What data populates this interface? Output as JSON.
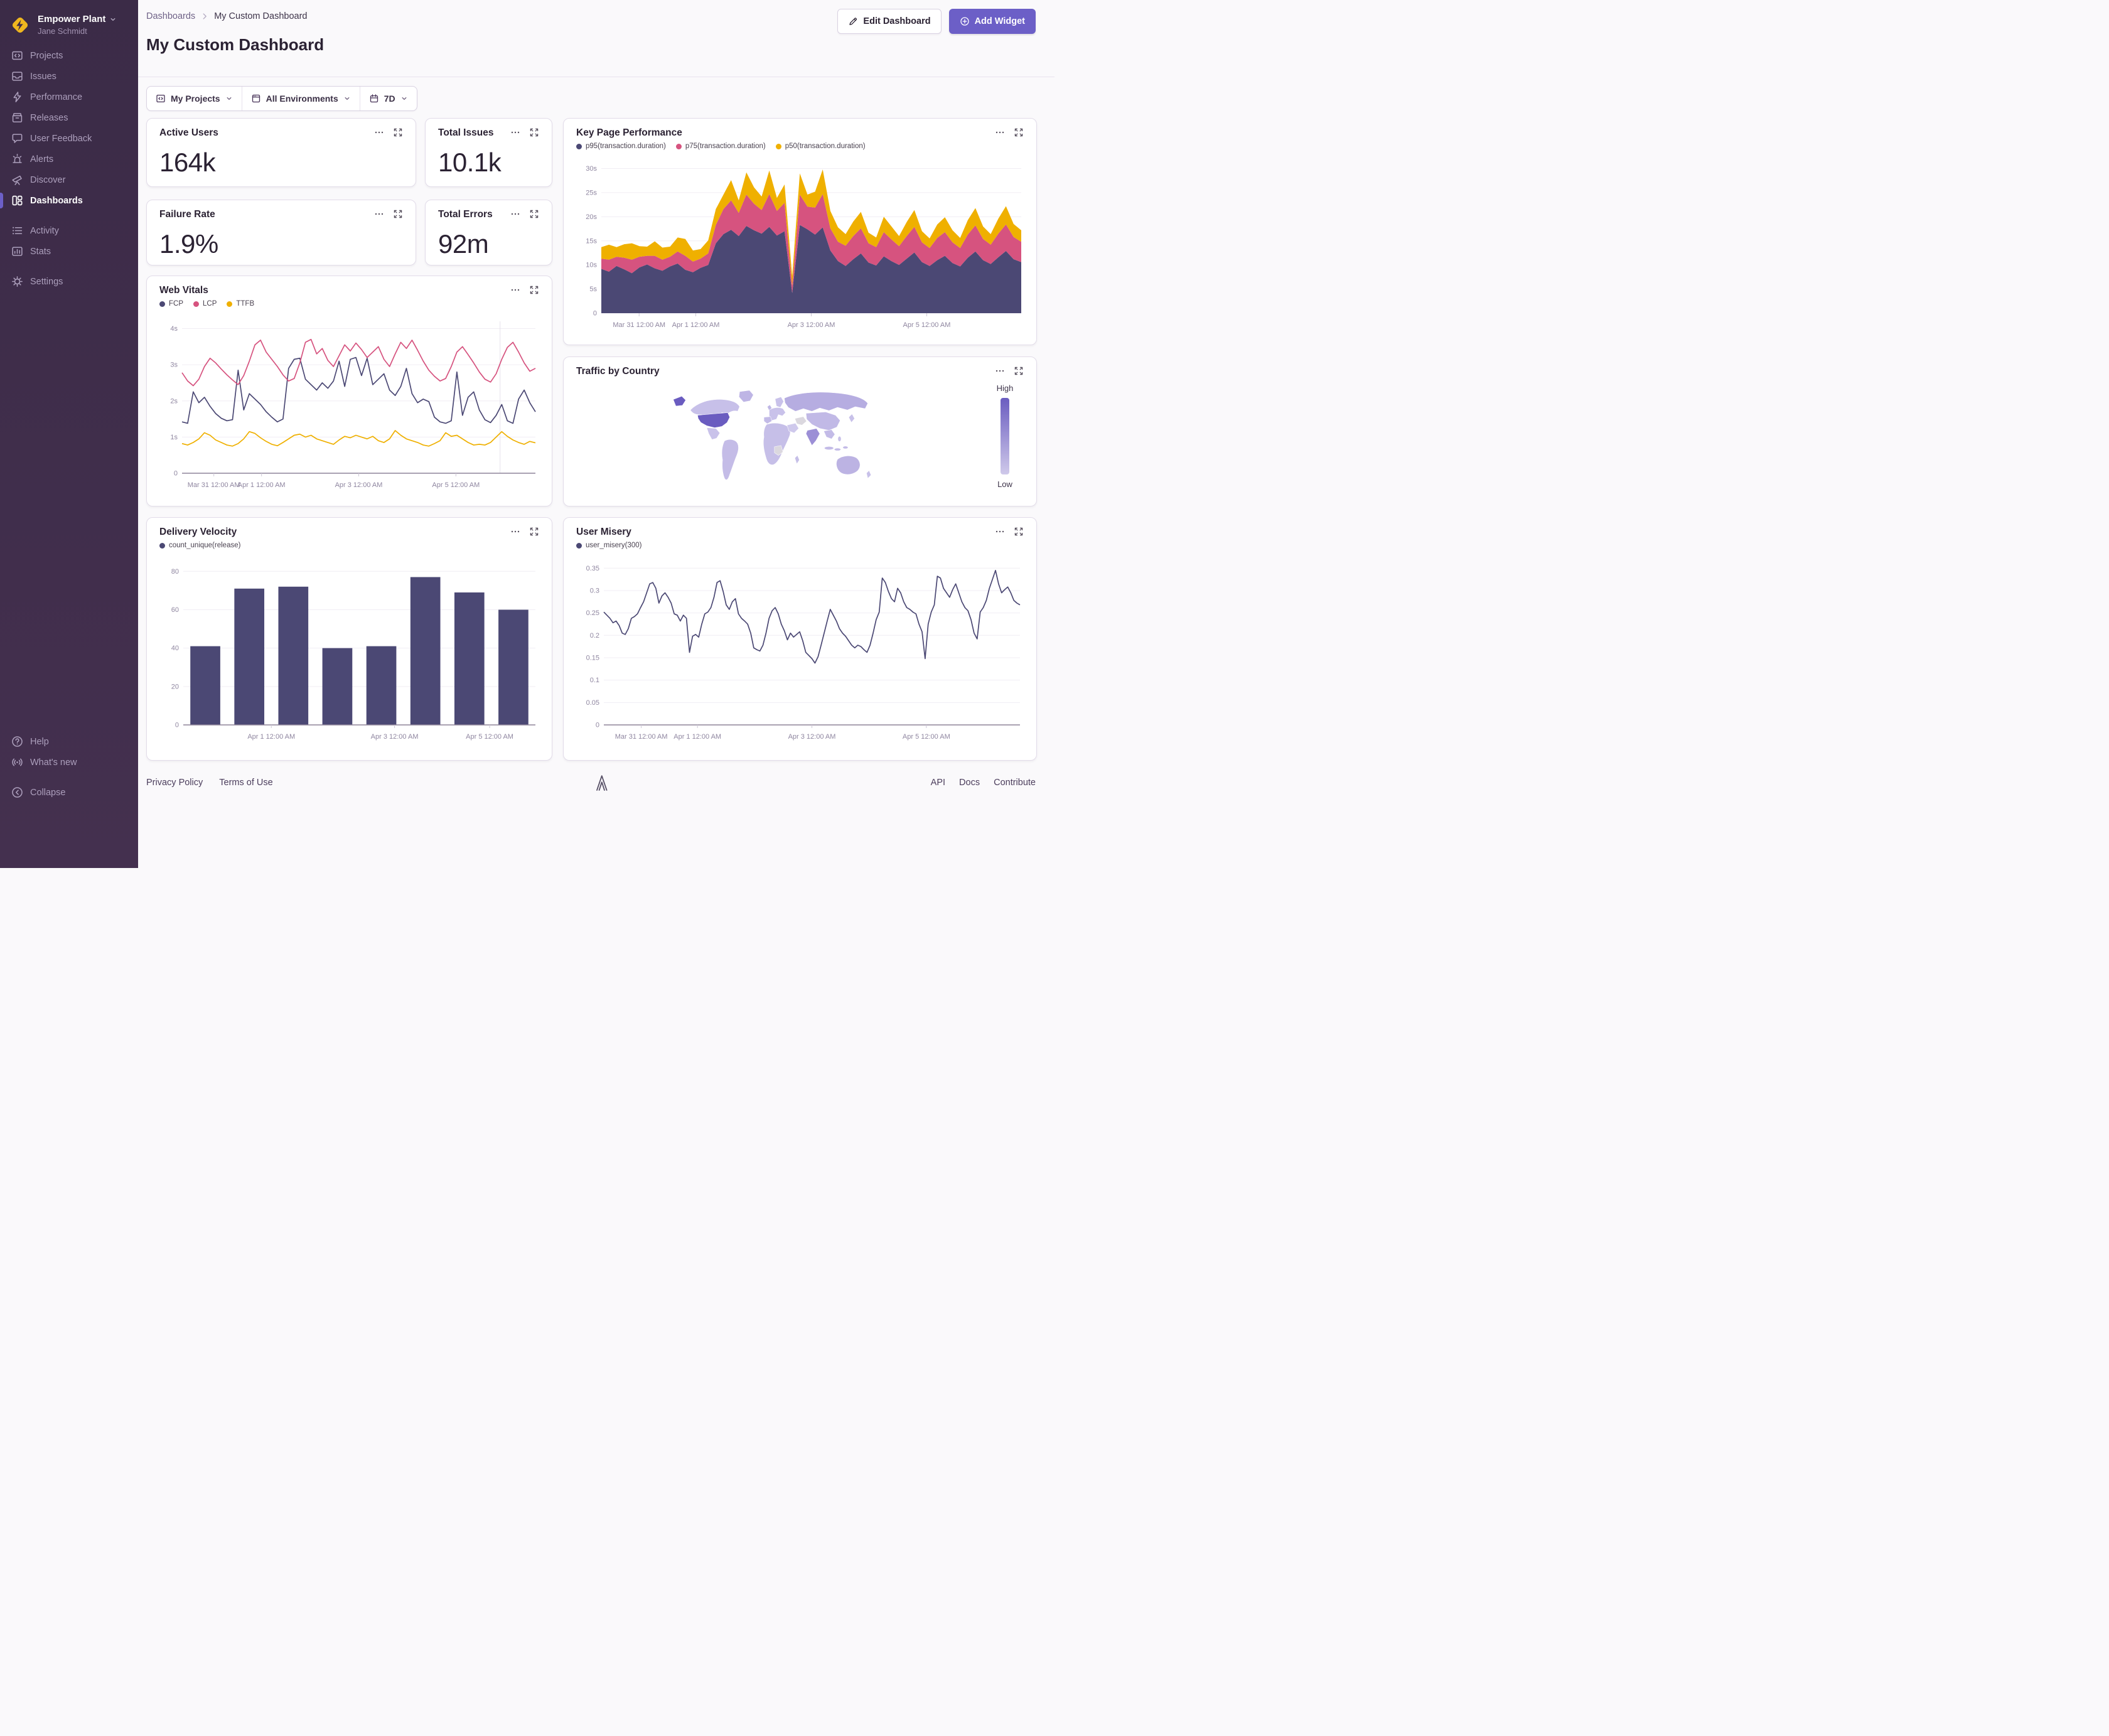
{
  "sidebar": {
    "org_name": "Empower Plant",
    "user_name": "Jane Schmidt",
    "items": [
      {
        "label": "Projects"
      },
      {
        "label": "Issues"
      },
      {
        "label": "Performance"
      },
      {
        "label": "Releases"
      },
      {
        "label": "User Feedback"
      },
      {
        "label": "Alerts"
      },
      {
        "label": "Discover"
      },
      {
        "label": "Dashboards",
        "active": true
      },
      {
        "label": "Activity"
      },
      {
        "label": "Stats"
      },
      {
        "label": "Settings"
      }
    ],
    "bottom_items": [
      {
        "label": "Help"
      },
      {
        "label": "What's new"
      },
      {
        "label": "Collapse"
      }
    ]
  },
  "header": {
    "breadcrumb": {
      "parent": "Dashboards",
      "current": "My Custom Dashboard"
    },
    "title": "My Custom Dashboard",
    "edit_button": "Edit Dashboard",
    "add_button": "Add Widget"
  },
  "filters": {
    "projects": "My Projects",
    "environments": "All Environments",
    "date_range": "7D"
  },
  "footer": {
    "privacy": "Privacy Policy",
    "terms": "Terms of Use",
    "api": "API",
    "docs": "Docs",
    "contribute": "Contribute"
  },
  "colors": {
    "accent": "#6C5FC7",
    "navy": "#4B4874",
    "pink": "#D6537F",
    "yellow": "#EFB000",
    "map_high": "#6A5CC0",
    "map_low": "#CFC9EA"
  },
  "chart_data": [
    {
      "id": "active-users",
      "type": "stat",
      "title": "Active Users",
      "value": "164k"
    },
    {
      "id": "total-issues",
      "type": "stat",
      "title": "Total Issues",
      "value": "10.1k"
    },
    {
      "id": "failure-rate",
      "type": "stat",
      "title": "Failure Rate",
      "value": "1.9%"
    },
    {
      "id": "total-errors",
      "type": "stat",
      "title": "Total Errors",
      "value": "92m"
    },
    {
      "id": "key-page-performance",
      "type": "area",
      "stacked": true,
      "title": "Key Page Performance",
      "ylim": [
        0,
        31.5
      ],
      "grid": true,
      "legend_position": "top-left",
      "axis_line": false,
      "yticks": [
        {
          "v": 0,
          "label": "0"
        },
        {
          "v": 5,
          "label": "5s"
        },
        {
          "v": 10,
          "label": "10s"
        },
        {
          "v": 15,
          "label": "15s"
        },
        {
          "v": 20,
          "label": "20s"
        },
        {
          "v": 25,
          "label": "25s"
        },
        {
          "v": 30,
          "label": "30s"
        }
      ],
      "xticks": [
        {
          "f": 0.09,
          "label": "Mar 31 12:00 AM"
        },
        {
          "f": 0.225,
          "label": "Apr 1 12:00 AM"
        },
        {
          "f": 0.5,
          "label": "Apr 3 12:00 AM"
        },
        {
          "f": 0.775,
          "label": "Apr 5 12:00 AM"
        }
      ],
      "series": [
        {
          "name": "p95(transaction.duration)",
          "color": "#4B4874",
          "values": [
            9.2,
            8.6,
            9.8,
            9.1,
            8.3,
            9.5,
            10.1,
            9.3,
            8.8,
            9.7,
            10.3,
            9.0,
            8.5,
            9.4,
            10.0,
            14.5,
            16.4,
            17.3,
            16.0,
            18.1,
            17.2,
            16.5,
            17.9,
            16.1,
            17.0,
            4.2,
            18.3,
            17.4,
            16.3,
            17.8,
            13.0,
            10.8,
            9.8,
            11.2,
            12.4,
            10.5,
            9.9,
            11.8,
            10.8,
            10.0,
            11.3,
            12.6,
            10.6,
            9.8,
            11.0,
            11.9,
            10.4,
            9.7,
            11.5,
            12.8,
            11.0,
            10.2,
            11.6,
            12.9,
            11.2,
            10.6
          ]
        },
        {
          "name": "p75(transaction.duration)",
          "color": "#D6537F",
          "values": [
            2.1,
            2.5,
            1.9,
            2.4,
            2.8,
            2.2,
            1.8,
            2.6,
            2.3,
            2.0,
            2.5,
            2.9,
            2.2,
            1.9,
            2.4,
            3.8,
            5.2,
            6.1,
            4.8,
            6.5,
            5.5,
            4.9,
            6.8,
            5.1,
            5.9,
            1.5,
            6.3,
            4.7,
            5.6,
            6.9,
            4.6,
            4.0,
            4.2,
            4.8,
            5.2,
            4.0,
            3.8,
            5.0,
            4.5,
            3.9,
            4.7,
            5.3,
            4.1,
            3.7,
            4.6,
            4.9,
            4.3,
            3.8,
            4.8,
            5.4,
            4.4,
            4.0,
            4.9,
            5.5,
            4.6,
            4.2
          ]
        },
        {
          "name": "p50(transaction.duration)",
          "color": "#EFB000",
          "values": [
            2.4,
            3.1,
            2.0,
            2.8,
            3.4,
            2.2,
            1.9,
            3.0,
            2.5,
            2.1,
            2.9,
            3.5,
            2.3,
            2.0,
            2.7,
            3.3,
            3.0,
            4.2,
            2.6,
            4.6,
            3.4,
            2.8,
            4.9,
            2.7,
            3.8,
            2.0,
            4.4,
            2.5,
            3.3,
            5.1,
            3.6,
            3.0,
            2.4,
            3.0,
            3.4,
            2.2,
            2.0,
            3.2,
            2.7,
            2.1,
            2.9,
            3.5,
            2.3,
            2.0,
            2.8,
            3.1,
            2.5,
            2.1,
            3.0,
            3.6,
            2.6,
            2.2,
            3.1,
            3.8,
            2.7,
            2.4
          ]
        }
      ]
    },
    {
      "id": "web-vitals",
      "type": "line",
      "title": "Web Vitals",
      "ylim": [
        0,
        4.2
      ],
      "grid": true,
      "legend_position": "top-left",
      "axis_line": true,
      "vline": 0.9,
      "yticks": [
        {
          "v": 0,
          "label": "0"
        },
        {
          "v": 1,
          "label": "1s"
        },
        {
          "v": 2,
          "label": "2s"
        },
        {
          "v": 3,
          "label": "3s"
        },
        {
          "v": 4,
          "label": "4s"
        }
      ],
      "xticks": [
        {
          "f": 0.09,
          "label": "Mar 31 12:00 AM"
        },
        {
          "f": 0.225,
          "label": "Apr 1 12:00 AM"
        },
        {
          "f": 0.5,
          "label": "Apr 3 12:00 AM"
        },
        {
          "f": 0.775,
          "label": "Apr 5 12:00 AM"
        }
      ],
      "series": [
        {
          "name": "FCP",
          "color": "#4B4874",
          "values": [
            1.42,
            1.38,
            2.25,
            1.95,
            2.1,
            1.85,
            1.65,
            1.52,
            1.45,
            1.48,
            2.85,
            1.75,
            2.2,
            2.05,
            1.9,
            1.7,
            1.55,
            1.42,
            1.5,
            2.9,
            3.15,
            3.18,
            2.6,
            2.45,
            2.3,
            2.5,
            2.35,
            2.55,
            3.1,
            2.4,
            3.15,
            3.2,
            2.7,
            3.18,
            2.45,
            2.6,
            2.75,
            2.3,
            2.15,
            2.4,
            2.9,
            2.2,
            1.95,
            2.05,
            1.98,
            1.55,
            1.42,
            1.38,
            1.45,
            2.8,
            1.6,
            2.1,
            2.25,
            1.75,
            1.48,
            1.4,
            1.6,
            1.9,
            1.45,
            1.38,
            2.05,
            2.3,
            1.95,
            1.7
          ]
        },
        {
          "name": "LCP",
          "color": "#D6537F",
          "values": [
            2.78,
            2.55,
            2.42,
            2.6,
            2.95,
            3.18,
            3.05,
            2.88,
            2.72,
            2.58,
            2.45,
            2.7,
            3.1,
            3.55,
            3.68,
            3.35,
            3.15,
            2.95,
            2.72,
            2.55,
            2.62,
            3.05,
            3.62,
            3.7,
            3.3,
            3.45,
            3.12,
            2.95,
            3.25,
            3.55,
            3.38,
            3.6,
            3.42,
            3.2,
            3.35,
            3.5,
            3.15,
            2.95,
            3.3,
            3.62,
            3.45,
            3.68,
            3.4,
            3.1,
            2.85,
            2.68,
            2.55,
            2.62,
            2.95,
            3.35,
            3.5,
            3.28,
            3.05,
            2.8,
            2.6,
            2.52,
            2.75,
            3.15,
            3.48,
            3.62,
            3.35,
            3.05,
            2.82,
            2.9
          ]
        },
        {
          "name": "TTFB",
          "color": "#EFB000",
          "values": [
            0.82,
            0.78,
            0.85,
            0.95,
            1.12,
            1.05,
            0.92,
            0.85,
            0.78,
            0.75,
            0.82,
            0.95,
            1.15,
            1.1,
            0.98,
            0.88,
            0.8,
            0.76,
            0.85,
            0.95,
            1.05,
            1.08,
            1.0,
            1.05,
            0.95,
            0.9,
            0.85,
            0.8,
            0.92,
            1.02,
            0.98,
            1.05,
            1.0,
            0.95,
            1.02,
            0.9,
            0.85,
            0.95,
            1.18,
            1.05,
            0.95,
            0.9,
            0.85,
            0.78,
            0.75,
            0.82,
            0.9,
            1.12,
            1.02,
            1.05,
            0.95,
            0.85,
            0.78,
            0.8,
            0.78,
            0.85,
            1.0,
            1.15,
            1.02,
            0.92,
            0.85,
            0.8,
            0.88,
            0.84
          ]
        }
      ]
    },
    {
      "id": "traffic-by-country",
      "type": "choropleth",
      "title": "Traffic by Country",
      "legend": {
        "high": "High",
        "low": "Low"
      },
      "highest_country": "United States"
    },
    {
      "id": "delivery-velocity",
      "type": "bar",
      "title": "Delivery Velocity",
      "categories": [
        "",
        "",
        "Apr 1 12:00 AM",
        "",
        "",
        "Apr 3 12:00 AM",
        "",
        "Apr 5 12:00 AM"
      ],
      "values": [
        41,
        71,
        72,
        40,
        41,
        77,
        69,
        60
      ],
      "color": "#4B4874",
      "ylim": [
        0,
        85
      ],
      "grid": true,
      "axis_line": true,
      "yticks": [
        {
          "v": 0,
          "label": "0"
        },
        {
          "v": 20,
          "label": "20"
        },
        {
          "v": 40,
          "label": "40"
        },
        {
          "v": 60,
          "label": "60"
        },
        {
          "v": 80,
          "label": "80"
        }
      ],
      "xticks": [
        {
          "f": 0.25,
          "label": "Apr 1 12:00 AM"
        },
        {
          "f": 0.6,
          "label": "Apr 3 12:00 AM"
        },
        {
          "f": 0.87,
          "label": "Apr 5 12:00 AM"
        }
      ],
      "series": [
        {
          "name": "count_unique(release)",
          "color": "#4B4874"
        }
      ]
    },
    {
      "id": "user-misery",
      "type": "line",
      "title": "User Misery",
      "ylim": [
        0,
        0.37
      ],
      "grid": true,
      "legend_position": "top-left",
      "axis_line": true,
      "yticks": [
        {
          "v": 0,
          "label": "0"
        },
        {
          "v": 0.05,
          "label": "0.05"
        },
        {
          "v": 0.1,
          "label": "0.1"
        },
        {
          "v": 0.15,
          "label": "0.15"
        },
        {
          "v": 0.2,
          "label": "0.2"
        },
        {
          "v": 0.25,
          "label": "0.25"
        },
        {
          "v": 0.3,
          "label": "0.3"
        },
        {
          "v": 0.35,
          "label": "0.35"
        }
      ],
      "xticks": [
        {
          "f": 0.09,
          "label": "Mar 31 12:00 AM"
        },
        {
          "f": 0.225,
          "label": "Apr 1 12:00 AM"
        },
        {
          "f": 0.5,
          "label": "Apr 3 12:00 AM"
        },
        {
          "f": 0.775,
          "label": "Apr 5 12:00 AM"
        }
      ],
      "series": [
        {
          "name": "user_misery(300)",
          "color": "#4B4874",
          "values": [
            0.252,
            0.245,
            0.238,
            0.228,
            0.232,
            0.222,
            0.205,
            0.202,
            0.215,
            0.238,
            0.242,
            0.248,
            0.262,
            0.275,
            0.295,
            0.315,
            0.318,
            0.305,
            0.272,
            0.288,
            0.295,
            0.285,
            0.272,
            0.248,
            0.245,
            0.232,
            0.245,
            0.238,
            0.162,
            0.198,
            0.202,
            0.196,
            0.225,
            0.248,
            0.252,
            0.262,
            0.285,
            0.318,
            0.322,
            0.298,
            0.268,
            0.258,
            0.275,
            0.282,
            0.248,
            0.238,
            0.232,
            0.225,
            0.205,
            0.172,
            0.168,
            0.165,
            0.178,
            0.205,
            0.238,
            0.255,
            0.262,
            0.248,
            0.225,
            0.21,
            0.19,
            0.205,
            0.196,
            0.202,
            0.208,
            0.188,
            0.162,
            0.155,
            0.148,
            0.138,
            0.152,
            0.178,
            0.205,
            0.232,
            0.258,
            0.245,
            0.232,
            0.215,
            0.205,
            0.198,
            0.188,
            0.178,
            0.172,
            0.178,
            0.175,
            0.168,
            0.162,
            0.178,
            0.205,
            0.235,
            0.252,
            0.328,
            0.318,
            0.298,
            0.282,
            0.275,
            0.305,
            0.295,
            0.275,
            0.262,
            0.258,
            0.252,
            0.248,
            0.225,
            0.208,
            0.148,
            0.225,
            0.252,
            0.268,
            0.332,
            0.328,
            0.305,
            0.295,
            0.285,
            0.302,
            0.315,
            0.295,
            0.275,
            0.262,
            0.255,
            0.235,
            0.205,
            0.192,
            0.252,
            0.262,
            0.278,
            0.305,
            0.325,
            0.345,
            0.315,
            0.295,
            0.302,
            0.308,
            0.295,
            0.278,
            0.272,
            0.268
          ]
        }
      ]
    }
  ]
}
